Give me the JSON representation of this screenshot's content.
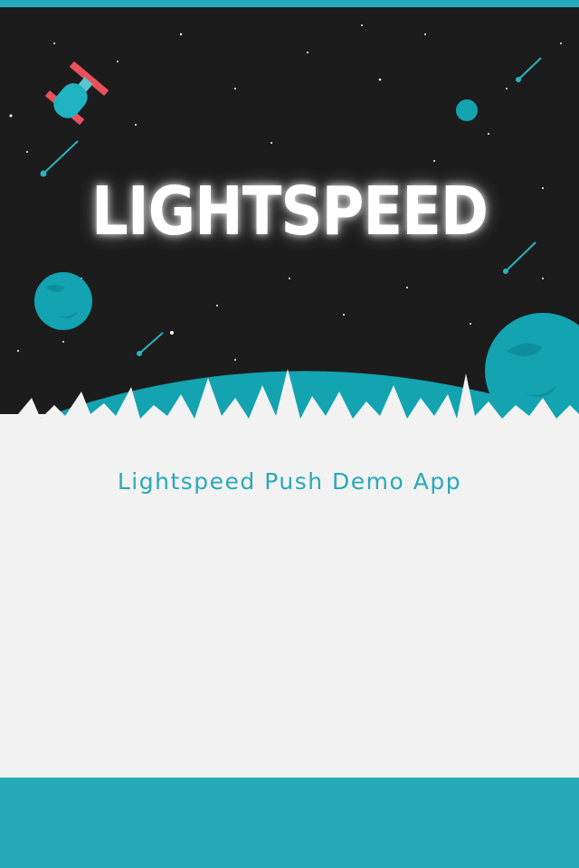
{
  "header": {
    "accent_color": "#26aab8"
  },
  "splash": {
    "logo_text": "LIGHTSPEED",
    "background_color": "#1b1b1b",
    "planet_color": "#13a3b1",
    "satellite_accent": "#e8505b",
    "icons": [
      "satellite-icon",
      "comet-icon",
      "planet-icon",
      "landscape-horizon"
    ]
  },
  "main": {
    "title": "Lightspeed Push Demo App",
    "title_color": "#2aa8b8",
    "background_color": "#f2f2f2"
  },
  "footer": {
    "color": "#26aab8"
  }
}
